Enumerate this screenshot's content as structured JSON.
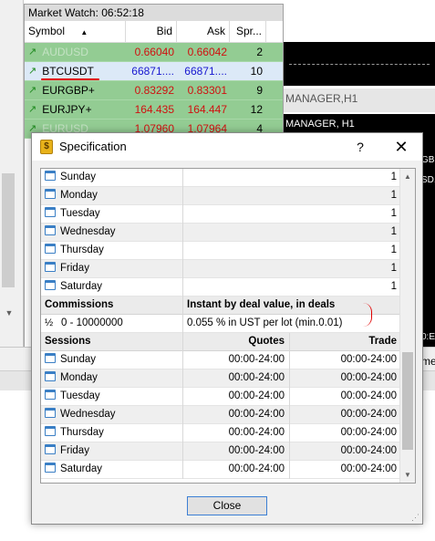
{
  "market_watch": {
    "title": "Market Watch: 06:52:18",
    "columns": {
      "symbol": "Symbol",
      "bid": "Bid",
      "ask": "Ask",
      "spread": "Spr..."
    },
    "rows": [
      {
        "symbol": "AUDUSD",
        "bid": "0.66040",
        "ask": "0.66042",
        "spread": "2"
      },
      {
        "symbol": "BTCUSDT",
        "bid": "66871....",
        "ask": "66871....",
        "spread": "10"
      },
      {
        "symbol": "EURGBP+",
        "bid": "0.83292",
        "ask": "0.83301",
        "spread": "9"
      },
      {
        "symbol": "EURJPY+",
        "bid": "164.435",
        "ask": "164.447",
        "spread": "12"
      },
      {
        "symbol": "EURUSD",
        "bid": "1.07960",
        "ask": "1.07964",
        "spread": "4"
      }
    ]
  },
  "chart": {
    "tab_title": "MANAGER,H1",
    "window_title": "MANAGER, H1",
    "fragments": [
      "GB",
      "SD,",
      "0:E",
      "me"
    ]
  },
  "dialog": {
    "title": "Specification",
    "help": "?",
    "close_x": "✕",
    "days_top": [
      {
        "day": "Sunday",
        "value": "1"
      },
      {
        "day": "Monday",
        "value": "1"
      },
      {
        "day": "Tuesday",
        "value": "1"
      },
      {
        "day": "Wednesday",
        "value": "1"
      },
      {
        "day": "Thursday",
        "value": "1"
      },
      {
        "day": "Friday",
        "value": "1"
      },
      {
        "day": "Saturday",
        "value": "1"
      }
    ],
    "commissions": {
      "header": "Commissions",
      "header_value": "Instant by deal value, in deals",
      "range": "0 - 10000000",
      "range_icon": "½",
      "value": "0.055 % in UST per lot (min.0.01)"
    },
    "sessions": {
      "header": "Sessions",
      "quotes_header": "Quotes",
      "trade_header": "Trade",
      "rows": [
        {
          "day": "Sunday",
          "quotes": "00:00-24:00",
          "trade": "00:00-24:00"
        },
        {
          "day": "Monday",
          "quotes": "00:00-24:00",
          "trade": "00:00-24:00"
        },
        {
          "day": "Tuesday",
          "quotes": "00:00-24:00",
          "trade": "00:00-24:00"
        },
        {
          "day": "Wednesday",
          "quotes": "00:00-24:00",
          "trade": "00:00-24:00"
        },
        {
          "day": "Thursday",
          "quotes": "00:00-24:00",
          "trade": "00:00-24:00"
        },
        {
          "day": "Friday",
          "quotes": "00:00-24:00",
          "trade": "00:00-24:00"
        },
        {
          "day": "Saturday",
          "quotes": "00:00-24:00",
          "trade": "00:00-24:00"
        }
      ]
    },
    "close_button": "Close"
  },
  "colors": {
    "accent_border": "#3c7fd4",
    "price_red": "#d01010",
    "price_blue": "#1818d0",
    "annotation_red": "#e00000"
  }
}
